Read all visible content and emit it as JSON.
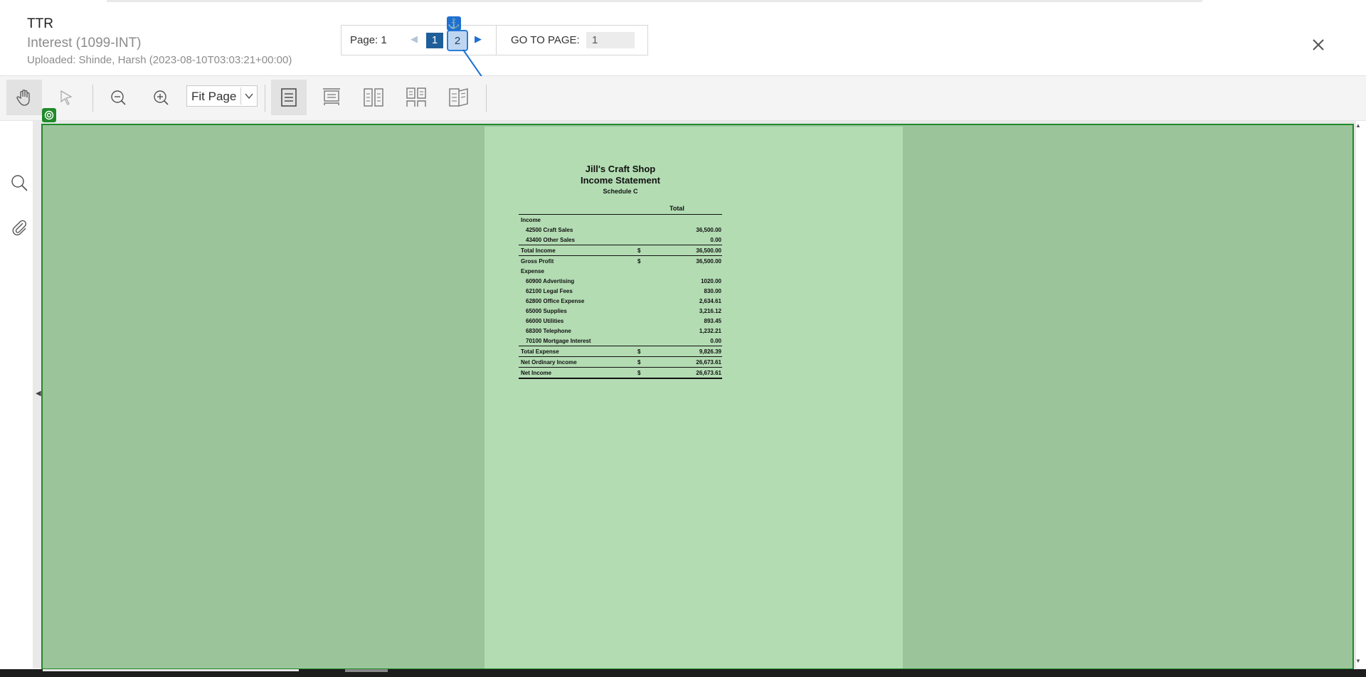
{
  "header": {
    "title": "TTR",
    "subtitle": "Interest (1099-INT)",
    "uploaded": "Uploaded: Shinde, Harsh (2023-08-10T03:03:21+00:00)"
  },
  "pager": {
    "page_label": "Page: 1",
    "pages": [
      "1",
      "2"
    ],
    "current_page": "1",
    "goto_label": "GO TO PAGE:",
    "goto_value": "1"
  },
  "toolbar": {
    "zoom_value": "Fit Page",
    "tools": [
      "pan-tool",
      "select-tool",
      "zoom-out",
      "zoom-in",
      "single-page",
      "continuous",
      "facing",
      "facing-continuous",
      "book-view"
    ]
  },
  "report": {
    "company": "Jill's Craft Shop",
    "title": "Income Statement",
    "subtitle": "Schedule C",
    "column": "Total",
    "rows": [
      {
        "label": "Income",
        "currency": "",
        "amount": ""
      },
      {
        "label": "42500 Craft Sales",
        "currency": "",
        "amount": "36,500.00"
      },
      {
        "label": "43400 Other Sales",
        "currency": "",
        "amount": "0.00"
      },
      {
        "label": "Total Income",
        "currency": "$",
        "amount": "36,500.00"
      },
      {
        "label": "Gross Profit",
        "currency": "$",
        "amount": "36,500.00"
      },
      {
        "label": "Expense",
        "currency": "",
        "amount": ""
      },
      {
        "label": "60900 Advertising",
        "currency": "",
        "amount": "1020.00"
      },
      {
        "label": "62100 Legal Fees",
        "currency": "",
        "amount": "830.00"
      },
      {
        "label": "62800 Office Expense",
        "currency": "",
        "amount": "2,634.61"
      },
      {
        "label": "65000 Supplies",
        "currency": "",
        "amount": "3,216.12"
      },
      {
        "label": "66000 Utilities",
        "currency": "",
        "amount": "893.45"
      },
      {
        "label": "68300 Telephone",
        "currency": "",
        "amount": "1,232.21"
      },
      {
        "label": "70100 Mortgage Interest",
        "currency": "",
        "amount": "0.00"
      },
      {
        "label": "Total Expense",
        "currency": "$",
        "amount": "9,826.39"
      },
      {
        "label": "Net Ordinary Income",
        "currency": "$",
        "amount": "26,673.61"
      },
      {
        "label": "Net Income",
        "currency": "$",
        "amount": "26,673.61"
      }
    ]
  },
  "colors": {
    "overlay_fill": "#9bc49b",
    "overlay_border": "#1f8a2a",
    "page_fill": "#b3dcb3",
    "active_page": "#1f5f99",
    "anchor": "#1f6fd1"
  }
}
